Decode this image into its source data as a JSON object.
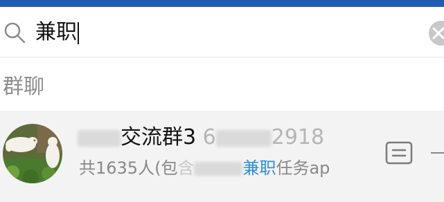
{
  "search": {
    "query": "兼职"
  },
  "section": {
    "title": "群聊"
  },
  "result": {
    "name_visible": "交流群3",
    "id_prefix": "6",
    "id_suffix": "2918",
    "desc_prefix": "共1635人(包",
    "desc_partial": "含",
    "desc_highlight": "兼职",
    "desc_suffix": "任务ap"
  },
  "colors": {
    "topbar": "#1f5fb3",
    "highlight": "#2e8fd6",
    "result_bg": "#f3f3f3"
  },
  "icons": [
    "search-icon",
    "clear-icon",
    "group-avatar",
    "card-icon"
  ]
}
